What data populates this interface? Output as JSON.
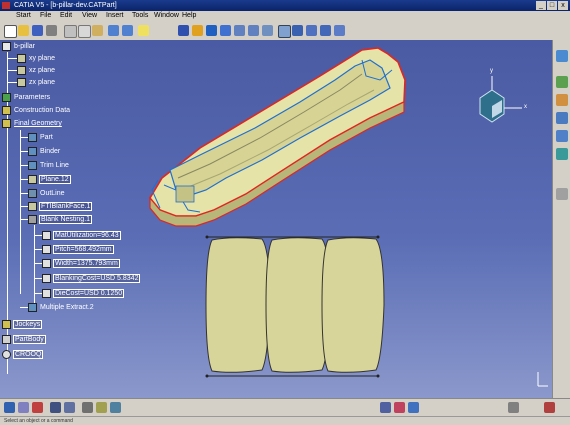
{
  "window": {
    "title": "CATIA V5 - [b-pillar-dev.CATPart]",
    "controls": [
      "_",
      "□",
      "x"
    ]
  },
  "menu": [
    "Start",
    "File",
    "Edit",
    "View",
    "Insert",
    "Tools",
    "Window",
    "Help"
  ],
  "tree": {
    "root": "b-pillar",
    "items": [
      {
        "label": "xy plane"
      },
      {
        "label": "xz plane"
      },
      {
        "label": "zx plane"
      },
      {
        "label": "Parameters"
      },
      {
        "label": "Construction Data"
      },
      {
        "label": "Final Geometry"
      },
      {
        "label": "Part"
      },
      {
        "label": "Binder"
      },
      {
        "label": "Trim Line"
      },
      {
        "label": "Plane.12"
      },
      {
        "label": "OutLine"
      },
      {
        "label": "FTIBlankFace.1"
      },
      {
        "label": "Blank Nesting.1"
      },
      {
        "label": "MatUtilization=96.43"
      },
      {
        "label": "Pitch=568.492mm"
      },
      {
        "label": "Width=1375.793mm"
      },
      {
        "label": "BlankingCost=USD 5.8342"
      },
      {
        "label": "DieCost=USD 0.1250"
      },
      {
        "label": "Multiple Extract.2"
      },
      {
        "label": "Jockeys"
      },
      {
        "label": "PartBody"
      },
      {
        "label": "CROOQ"
      }
    ]
  },
  "compass_axes": {
    "x": "x",
    "y": "y"
  },
  "status": "Select an object or a command",
  "colors": {
    "viewport_top": "#4a5aa3",
    "viewport_bottom": "#8b98cc",
    "part_fill": "#e6e3a8",
    "trim_red": "#e0261f",
    "edge_blue": "#1e6fd0",
    "blank_fill": "#d8d59a"
  }
}
